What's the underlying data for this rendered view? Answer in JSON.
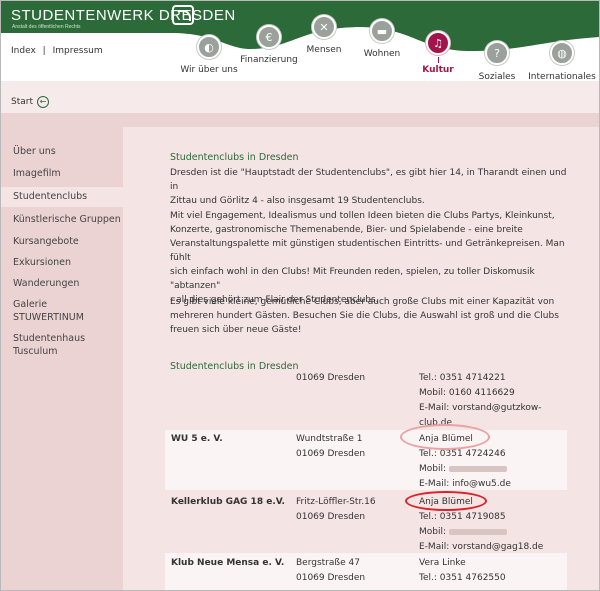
{
  "brand": {
    "title": "STUDENTENWERK DRESDEN",
    "subtitle": "Anstalt des öffentlichen Rechts"
  },
  "top_links": {
    "index": "Index",
    "separator": "|",
    "impressum": "Impressum"
  },
  "start": {
    "label": "Start"
  },
  "nav": [
    {
      "label": "Wir über uns",
      "icon": "transport-icon"
    },
    {
      "label": "Finanzierung",
      "icon": "euro-icon"
    },
    {
      "label": "Mensen",
      "icon": "cutlery-icon"
    },
    {
      "label": "Wohnen",
      "icon": "sofa-icon"
    },
    {
      "label": "Kultur",
      "icon": "music-icon",
      "active": true
    },
    {
      "label": "Soziales",
      "icon": "question-icon"
    },
    {
      "label": "Internationales",
      "icon": "globe-icon"
    }
  ],
  "sidebar": [
    "Über uns",
    "Imagefilm",
    "Studentenclubs",
    "Künstlerische Gruppen",
    "Kursangebote",
    "Exkursionen",
    "Wanderungen",
    "Galerie",
    "STUWERTINUM",
    "Studentenhaus",
    "Tusculum"
  ],
  "content": {
    "heading": "Studentenclubs in Dresden",
    "p1": [
      "Dresden ist die \"Hauptstadt der Studentenclubs\", es gibt hier 14, in Tharandt einen und in",
      "Zittau und Görlitz 4 - also insgesamt 19 Studentenclubs."
    ],
    "p2": [
      "Mit viel Engagement, Idealismus und tollen Ideen bieten die Clubs Partys, Kleinkunst,",
      "Konzerte, gastronomische Themenabende, Bier- und Spielabende - eine breite",
      "Veranstaltungspalette mit günstigen studentischen Eintritts- und Getränkepreisen. Man fühlt",
      "sich einfach wohl in den Clubs! Mit Freunden reden, spielen, zu toller Diskomusik \"abtanzen\"",
      "- all dies gehört zum Flair der Studentenclubs."
    ],
    "p3": [
      "Es gibt viele kleine, gemütliche Clubs, aber auch große Clubs mit einer Kapazität von",
      "mehreren hundert Gästen. Besuchen Sie die Clubs, die Auswahl ist groß und die Clubs",
      "freuen sich über neue Gäste!"
    ],
    "table_heading": "Studentenclubs in Dresden"
  },
  "clubs": [
    {
      "name": "",
      "address": [
        "01069 Dresden"
      ],
      "contact": [
        "Tel.: 0351 4714221",
        "Mobil: 0160 4116629",
        "E-Mail: vorstand@gutzkow-",
        "club.de"
      ]
    },
    {
      "name": "WU 5 e. V.",
      "address": [
        "Wundtstraße 1",
        "01069 Dresden"
      ],
      "contact": [
        "Anja Blümel",
        "Tel.: 0351 4724246",
        "Mobil:",
        "E-Mail: info@wu5.de"
      ]
    },
    {
      "name": "Kellerklub GAG 18 e.V.",
      "address": [
        "Fritz-Löffler-Str.16",
        "01069 Dresden"
      ],
      "contact": [
        "Anja Blümel",
        "Tel.: 0351 4719085",
        "Mobil:",
        "E-Mail: vorstand@gag18.de"
      ]
    },
    {
      "name": "Klub Neue Mensa e. V.",
      "address": [
        "Bergstraße 47",
        "01069 Dresden"
      ],
      "contact": [
        "Vera Linke",
        "Tel.: 0351 4762550"
      ]
    }
  ],
  "colors": {
    "brand_green": "#2d6a3a",
    "active_magenta": "#a3144a",
    "sidebar_pink": "#ecd3d3",
    "content_pink": "#f4e4e4",
    "highlight_red": "#d9222a"
  }
}
